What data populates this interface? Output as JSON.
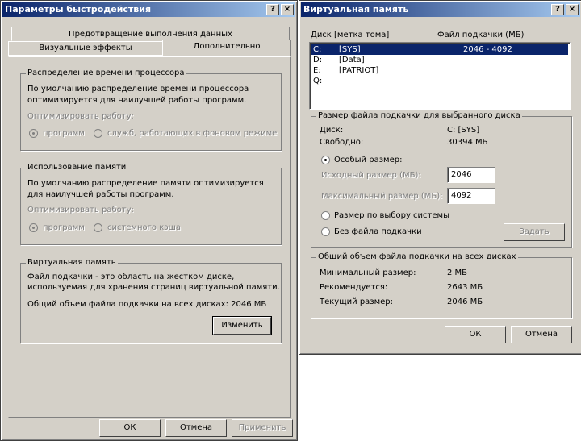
{
  "perf": {
    "title": "Параметры быстродействия",
    "help": "?",
    "close": "×",
    "tabs": {
      "dep": "Предотвращение выполнения данных",
      "visual": "Визуальные эффекты",
      "advanced": "Дополнительно"
    },
    "cpu": {
      "label": "Распределение времени процессора",
      "desc1": "По умолчанию распределение времени процессора",
      "desc2": "оптимизируется для наилучшей работы программ.",
      "opt": "Оптимизировать работу:",
      "r1": "программ",
      "r2": "служб, работающих в фоновом режиме"
    },
    "mem": {
      "label": "Использование памяти",
      "desc1": "По умолчанию распределение памяти оптимизируется",
      "desc2": "для наилучшей работы программ.",
      "opt": "Оптимизировать работу:",
      "r1": "программ",
      "r2": "системного кэша"
    },
    "vm": {
      "label": "Виртуальная память",
      "desc1": "Файл подкачки - это область на жестком диске,",
      "desc2": "используемая для хранения страниц виртуальной памяти.",
      "total": "Общий объем файла подкачки на всех дисках:  2046 МБ",
      "change": "Изменить"
    },
    "ok": "ОК",
    "cancel": "Отмена",
    "apply": "Применить"
  },
  "vmem": {
    "title": "Виртуальная память",
    "help": "?",
    "close": "×",
    "col_drive": "Диск [метка тома]",
    "col_file": "Файл подкачки (МБ)",
    "drives": [
      {
        "letter": "C:",
        "label": "[SYS]",
        "size": "2046 - 4092"
      },
      {
        "letter": "D:",
        "label": "[Data]",
        "size": ""
      },
      {
        "letter": "E:",
        "label": "[PATRIOT]",
        "size": ""
      },
      {
        "letter": "Q:",
        "label": "",
        "size": ""
      }
    ],
    "sel": {
      "label": "Размер файла подкачки для выбранного диска",
      "disk_k": "Диск:",
      "disk_v": "C:  [SYS]",
      "free_k": "Свободно:",
      "free_v": "30394 МБ",
      "custom": "Особый размер:",
      "initial": "Исходный размер (МБ):",
      "initial_val": "2046",
      "max": "Максимальный размер (МБ):",
      "max_val": "4092",
      "system": "Размер по выбору системы",
      "none": "Без файла подкачки",
      "set": "Задать"
    },
    "totals": {
      "label": "Общий объем файла подкачки на всех дисках",
      "min_k": "Минимальный размер:",
      "min_v": "2 МБ",
      "rec_k": "Рекомендуется:",
      "rec_v": "2643 МБ",
      "cur_k": "Текущий размер:",
      "cur_v": "2046 МБ"
    },
    "ok": "ОК",
    "cancel": "Отмена"
  }
}
